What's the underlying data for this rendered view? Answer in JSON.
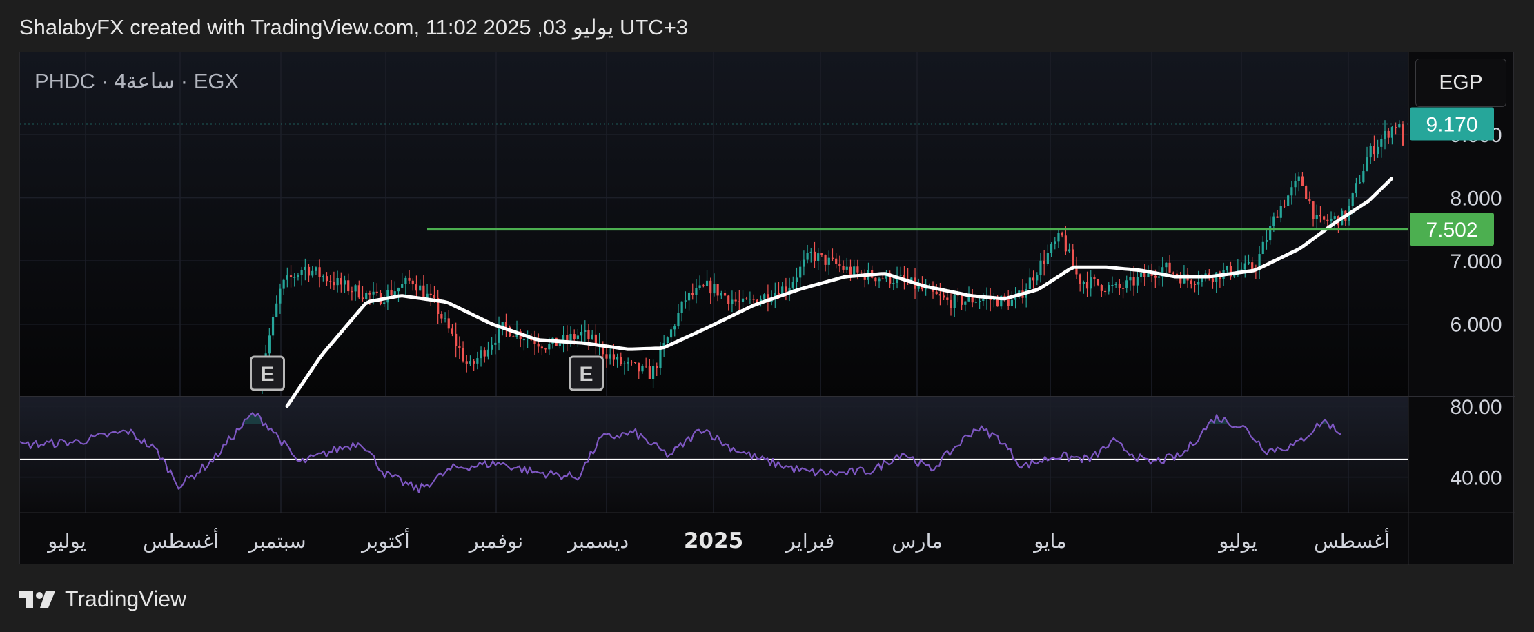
{
  "header": {
    "title": "ShalabyFX created with TradingView.com, 11:02 2025 ,03 يوليو UTC+3"
  },
  "symbol": {
    "label": "PHDC · 4ساعة · EGX"
  },
  "currency": {
    "label": "EGP"
  },
  "footer": {
    "brand": "TradingView"
  },
  "colors": {
    "up": "#26a69a",
    "down": "#ef5350",
    "ma": "#ffffff",
    "level": "#4caf50",
    "rsi": "#7e57c2",
    "last_price_badge": "#26a69a",
    "level_badge": "#4caf50"
  },
  "chart_data": {
    "type": "candlestick",
    "price_axis": {
      "ticks": [
        "9.000",
        "8.000",
        "7.000",
        "6.000"
      ],
      "tick_values": [
        9,
        8,
        7,
        6
      ],
      "ylim": [
        4.85,
        10.3
      ]
    },
    "rsi_axis": {
      "ticks": [
        "80.00",
        "40.00"
      ],
      "tick_values": [
        80,
        40
      ],
      "ylim": [
        20,
        85
      ],
      "reference_line": 50
    },
    "time_axis": {
      "labels": [
        "يوليو",
        "أغسطس",
        "سبتمبر",
        "أكتوبر",
        "نوفمبر",
        "ديسمبر",
        "2025",
        "فبراير",
        "مارس",
        "مايو",
        "يوليو",
        "أغسطس"
      ],
      "bold_label": "2025"
    },
    "last_price": {
      "value": 9.17,
      "label": "9.170"
    },
    "horizontal_level": {
      "value": 7.502,
      "label": "7.502",
      "start_month_index": 3
    },
    "earnings_markers": [
      {
        "label": "E",
        "month_index": 1.7
      },
      {
        "label": "E",
        "month_index": 4.5
      }
    ],
    "price_anchors": [
      [
        0.0,
        4.9
      ],
      [
        1.55,
        5.1
      ],
      [
        1.75,
        6.6
      ],
      [
        1.95,
        6.9
      ],
      [
        2.3,
        6.6
      ],
      [
        2.6,
        6.4
      ],
      [
        2.9,
        6.7
      ],
      [
        3.1,
        6.3
      ],
      [
        3.4,
        5.3
      ],
      [
        3.7,
        5.95
      ],
      [
        4.1,
        5.65
      ],
      [
        4.4,
        5.85
      ],
      [
        4.7,
        5.4
      ],
      [
        5.0,
        5.2
      ],
      [
        5.3,
        6.4
      ],
      [
        5.5,
        6.6
      ],
      [
        5.8,
        6.3
      ],
      [
        6.2,
        6.6
      ],
      [
        6.4,
        7.1
      ],
      [
        6.8,
        6.8
      ],
      [
        7.2,
        6.7
      ],
      [
        7.6,
        6.35
      ],
      [
        7.9,
        6.4
      ],
      [
        8.2,
        6.35
      ],
      [
        8.4,
        6.9
      ],
      [
        8.6,
        7.4
      ],
      [
        8.75,
        6.7
      ],
      [
        9.1,
        6.55
      ],
      [
        9.5,
        6.9
      ],
      [
        9.7,
        6.7
      ],
      [
        10.0,
        6.8
      ],
      [
        10.3,
        6.9
      ],
      [
        10.5,
        7.8
      ],
      [
        10.7,
        8.3
      ],
      [
        10.85,
        7.6
      ],
      [
        11.1,
        7.7
      ],
      [
        11.3,
        8.7
      ],
      [
        11.55,
        9.2
      ],
      [
        11.6,
        8.9
      ]
    ],
    "ma_anchors": [
      [
        1.8,
        4.7
      ],
      [
        2.1,
        5.5
      ],
      [
        2.5,
        6.35
      ],
      [
        2.8,
        6.45
      ],
      [
        3.2,
        6.35
      ],
      [
        3.6,
        6.0
      ],
      [
        4.0,
        5.75
      ],
      [
        4.4,
        5.7
      ],
      [
        4.8,
        5.6
      ],
      [
        5.1,
        5.62
      ],
      [
        5.5,
        5.95
      ],
      [
        5.9,
        6.3
      ],
      [
        6.3,
        6.55
      ],
      [
        6.7,
        6.75
      ],
      [
        7.05,
        6.8
      ],
      [
        7.4,
        6.6
      ],
      [
        7.8,
        6.45
      ],
      [
        8.1,
        6.4
      ],
      [
        8.4,
        6.55
      ],
      [
        8.7,
        6.9
      ],
      [
        9.0,
        6.9
      ],
      [
        9.3,
        6.85
      ],
      [
        9.6,
        6.75
      ],
      [
        9.9,
        6.75
      ],
      [
        10.3,
        6.85
      ],
      [
        10.7,
        7.2
      ],
      [
        11.0,
        7.6
      ],
      [
        11.3,
        7.95
      ],
      [
        11.5,
        8.3
      ]
    ],
    "rsi_anchors": [
      [
        0.0,
        58
      ],
      [
        0.5,
        60
      ],
      [
        0.95,
        66
      ],
      [
        1.2,
        55
      ],
      [
        1.4,
        35
      ],
      [
        1.7,
        50
      ],
      [
        1.85,
        62
      ],
      [
        2.05,
        76
      ],
      [
        2.2,
        68
      ],
      [
        2.45,
        48
      ],
      [
        2.8,
        56
      ],
      [
        3.0,
        60
      ],
      [
        3.2,
        42
      ],
      [
        3.5,
        33
      ],
      [
        3.8,
        45
      ],
      [
        4.2,
        48
      ],
      [
        4.5,
        43
      ],
      [
        4.9,
        40
      ],
      [
        5.1,
        62
      ],
      [
        5.4,
        65
      ],
      [
        5.7,
        52
      ],
      [
        6.0,
        68
      ],
      [
        6.2,
        58
      ],
      [
        6.5,
        50
      ],
      [
        6.9,
        43
      ],
      [
        7.2,
        42
      ],
      [
        7.5,
        44
      ],
      [
        7.75,
        54
      ],
      [
        8.0,
        44
      ],
      [
        8.4,
        68
      ],
      [
        8.6,
        62
      ],
      [
        8.8,
        46
      ],
      [
        9.1,
        52
      ],
      [
        9.4,
        50
      ],
      [
        9.6,
        60
      ],
      [
        9.9,
        48
      ],
      [
        10.2,
        52
      ],
      [
        10.5,
        74
      ],
      [
        10.75,
        68
      ],
      [
        10.95,
        55
      ],
      [
        11.2,
        58
      ],
      [
        11.45,
        72
      ],
      [
        11.6,
        65
      ]
    ]
  }
}
